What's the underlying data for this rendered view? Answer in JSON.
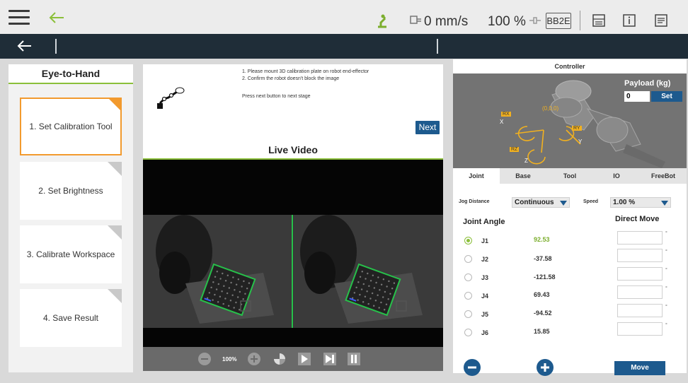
{
  "topbar": {
    "speed": "0 mm/s",
    "percent": "100 %",
    "badge": "BB2E"
  },
  "left": {
    "title": "Eye-to-Hand",
    "steps": [
      {
        "label": "1. Set Calibration Tool"
      },
      {
        "label": "2. Set Brightness"
      },
      {
        "label": "3. Calibrate Workspace"
      },
      {
        "label": "4.  Save Result"
      }
    ]
  },
  "instructions": {
    "line1": "1. Please mount 3D calibration plate on robot end-effector",
    "line2": "2. Confirm the robot doesn't block the image",
    "line3": "Press next button to next stage",
    "next_label": "Next"
  },
  "video": {
    "title": "Live Video",
    "zoom": "100%"
  },
  "controller": {
    "title": "Controller",
    "payload_label": "Payload (kg)",
    "payload_value": "0",
    "set_label": "Set",
    "axis_labels": {
      "rx": "RX",
      "ry": "RY",
      "rz": "RZ",
      "x": "X",
      "y": "Y",
      "z": "Z",
      "origin": "(0,0,0)"
    },
    "tabs": [
      "Joint",
      "Base",
      "Tool",
      "IO",
      "FreeBot"
    ],
    "jog_distance_label": "Jog Distance",
    "jog_distance_value": "Continuous",
    "speed_label": "Speed",
    "speed_value": "1.00 %",
    "joint_angle_label": "Joint Angle",
    "direct_move_label": "Direct Move",
    "joints": [
      {
        "name": "J1",
        "value": "92.53"
      },
      {
        "name": "J2",
        "value": "-37.58"
      },
      {
        "name": "J3",
        "value": "-121.58"
      },
      {
        "name": "J4",
        "value": "69.43"
      },
      {
        "name": "J5",
        "value": "-94.52"
      },
      {
        "name": "J6",
        "value": "15.85"
      }
    ],
    "degree_symbol": "°",
    "move_label": "Move"
  },
  "colors": {
    "accent_green": "#8bbf3a",
    "accent_orange": "#f29a2e",
    "primary_blue": "#1d5a8e",
    "dark_bar": "#1f2d38"
  }
}
